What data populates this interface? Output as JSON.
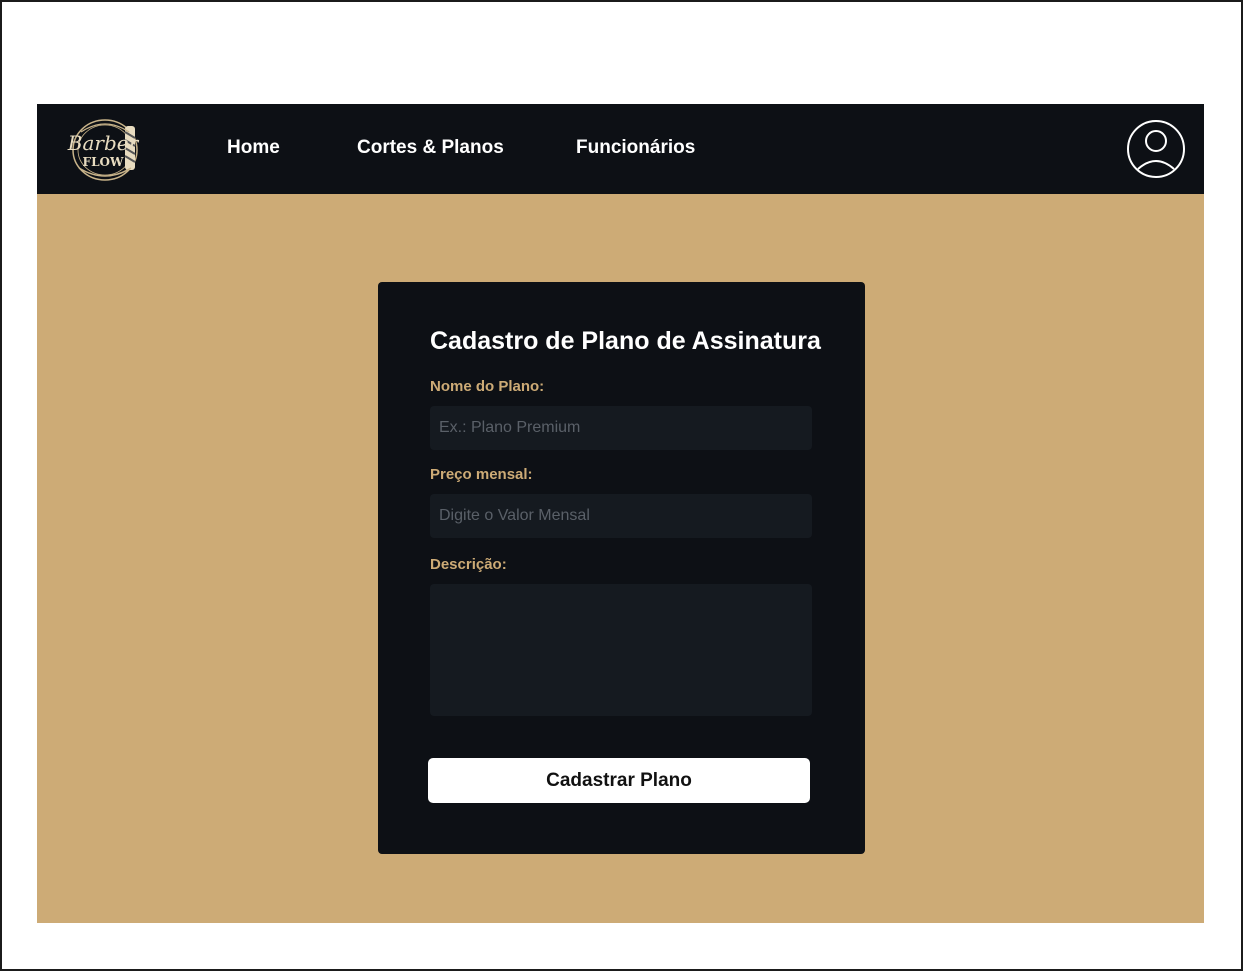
{
  "brand": {
    "logo_text_top": "Barber",
    "logo_text_bottom": "FLOW",
    "logo_icon": "barber-pole-icon"
  },
  "nav": {
    "items": [
      {
        "label": "Home"
      },
      {
        "label": "Cortes & Planos"
      },
      {
        "label": "Funcionários"
      }
    ],
    "profile_icon": "user-circle-icon"
  },
  "form": {
    "title": "Cadastro de Plano de Assinatura",
    "fields": {
      "nome": {
        "label": "Nome do Plano:",
        "placeholder": "Ex.: Plano Premium",
        "value": ""
      },
      "preco": {
        "label": "Preço mensal:",
        "placeholder": "Digite o Valor Mensal",
        "value": ""
      },
      "descricao": {
        "label": "Descrição:",
        "placeholder": "",
        "value": ""
      }
    },
    "submit_label": "Cadastrar Plano"
  },
  "colors": {
    "nav_bg": "#0d1015",
    "page_bg": "#cdab76",
    "accent": "#cdab76",
    "input_bg": "#151a20"
  }
}
